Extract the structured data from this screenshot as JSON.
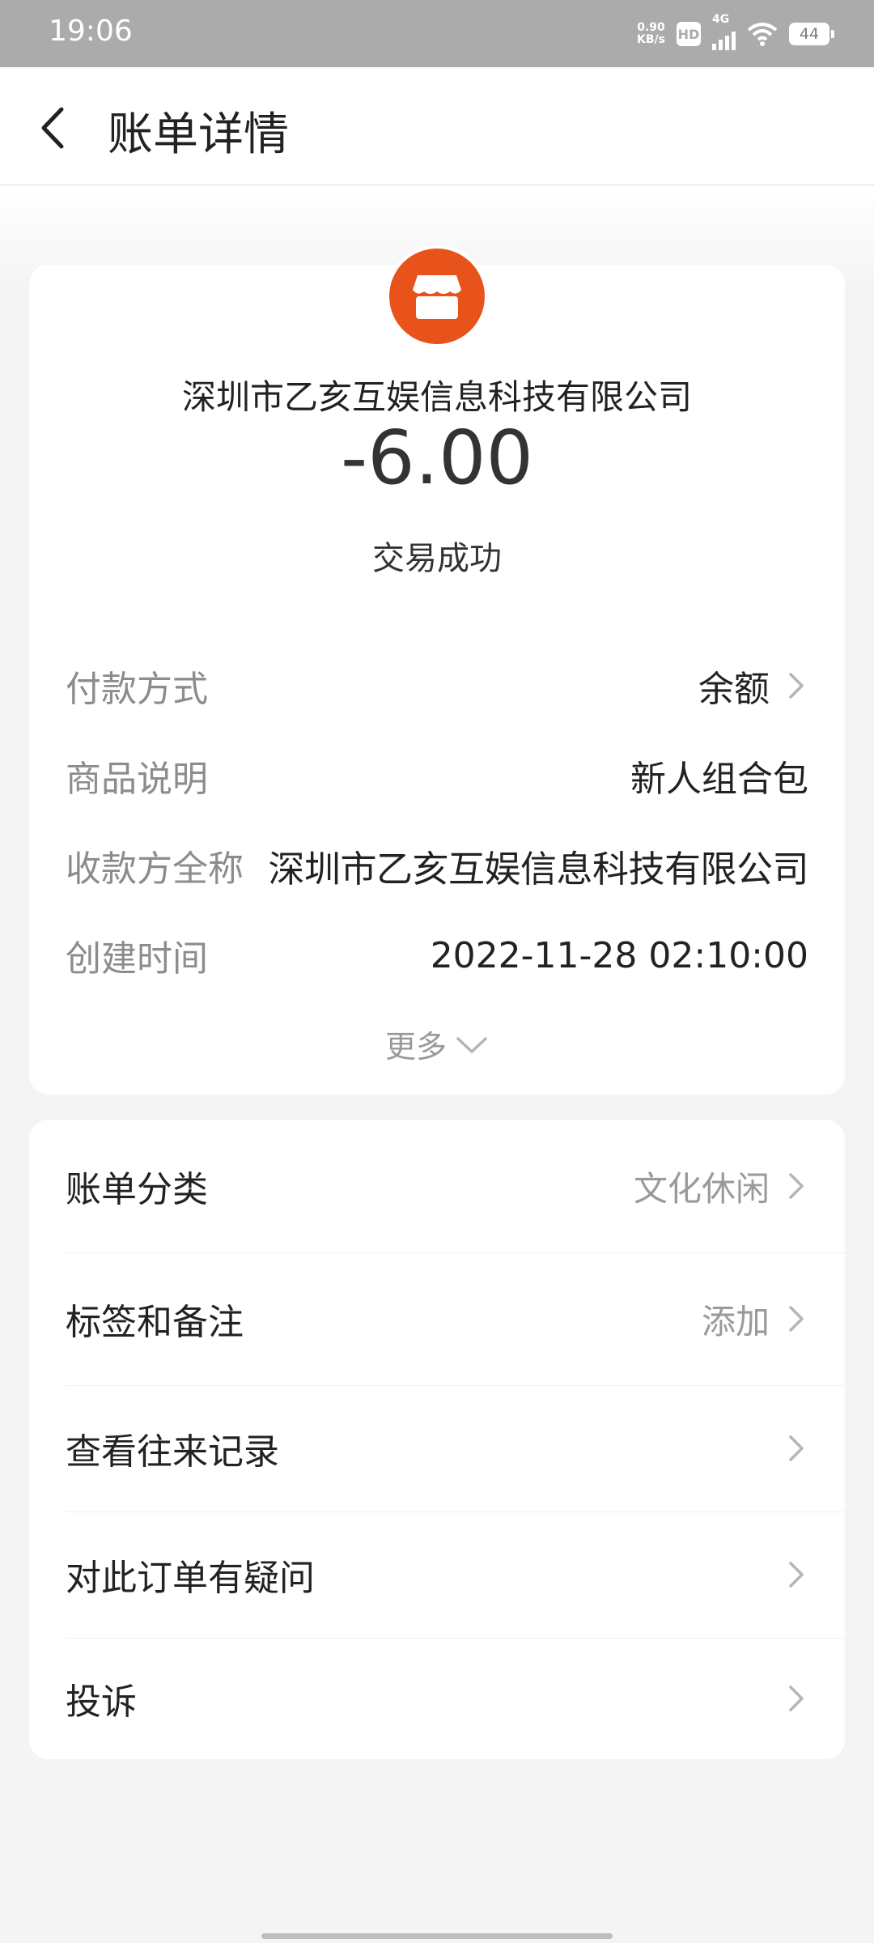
{
  "status_bar": {
    "time": "19:06",
    "net_speed_value": "0.90",
    "net_speed_unit": "KB/s",
    "hd": "HD",
    "network": "4G",
    "battery": "44"
  },
  "header": {
    "back_icon": "chevron-left-icon",
    "title": "账单详情"
  },
  "summary": {
    "merchant_icon": "store-icon",
    "merchant_name": "深圳市乙亥互娱信息科技有限公司",
    "amount": "-6.00",
    "status": "交易成功",
    "accent_color": "#e8531b"
  },
  "details": [
    {
      "label": "付款方式",
      "value": "余额",
      "has_chevron": true
    },
    {
      "label": "商品说明",
      "value": "新人组合包",
      "has_chevron": false
    },
    {
      "label": "收款方全称",
      "value": "深圳市乙亥互娱信息科技有限公司",
      "has_chevron": false
    },
    {
      "label": "创建时间",
      "value": "2022-11-28 02:10:00",
      "has_chevron": false
    }
  ],
  "more_label": "更多",
  "menu": [
    {
      "label": "账单分类",
      "value": "文化休闲"
    },
    {
      "label": "标签和备注",
      "value": "添加"
    },
    {
      "label": "查看往来记录",
      "value": ""
    },
    {
      "label": "对此订单有疑问",
      "value": ""
    },
    {
      "label": "投诉",
      "value": ""
    }
  ]
}
